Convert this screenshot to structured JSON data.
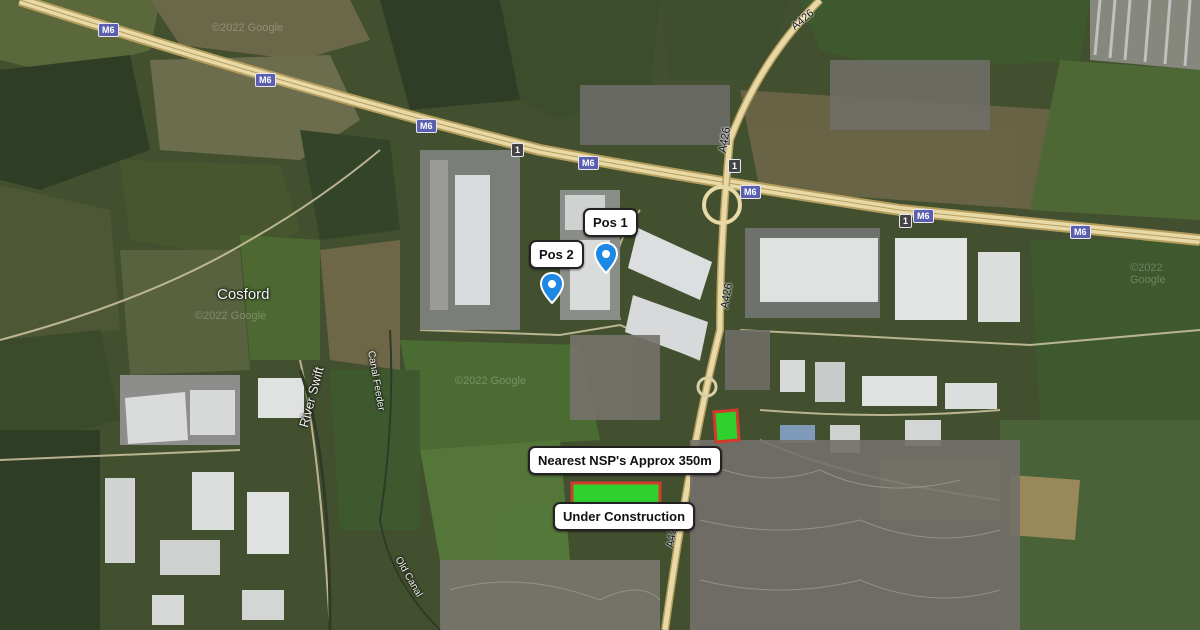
{
  "place": "Cosford",
  "river": "River Swift",
  "canal_feeder": "Canal Feeder",
  "old_canal": "Old Canal",
  "roads": {
    "m6": "M6",
    "a426": "A426",
    "a426_south": "A42",
    "junction": "1"
  },
  "markers": {
    "pos1": "Pos 1",
    "pos2": "Pos 2"
  },
  "annotations": {
    "nearest_nsp": "Nearest NSP's Approx 350m",
    "under_construction": "Under Construction"
  },
  "watermark": "©2022 Google",
  "colors": {
    "pin": "#1e88e5",
    "site_fill": "#2fd12f",
    "site_border": "#d23b2b",
    "motorway": "#e8d9a6"
  }
}
